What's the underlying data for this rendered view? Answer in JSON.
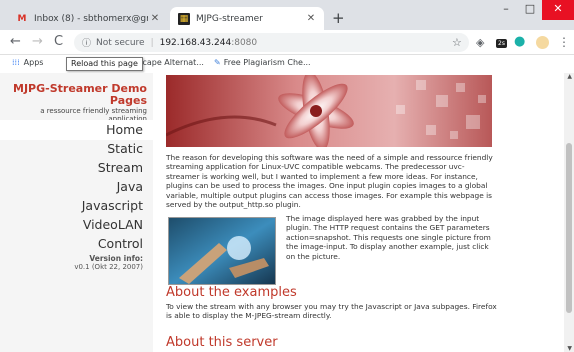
{
  "browser": {
    "tabs": [
      {
        "title": "Inbox (8) - sbthomerx@gmail.co",
        "close": "✕"
      },
      {
        "title": "MJPG-streamer",
        "close": "✕"
      }
    ],
    "new_tab": "+",
    "window_controls": {
      "minimize": "–",
      "maximize": "□",
      "close": "✕"
    },
    "nav": {
      "back": "←",
      "forward": "→",
      "reload": "C"
    },
    "address": {
      "security": "Not secure",
      "host": "192.168.43.244",
      "port": ":8080"
    },
    "bookmarks": [
      {
        "label": "Apps"
      },
      {
        "label": "Copyscape Alternat..."
      },
      {
        "label": "Free Plagiarism Che..."
      }
    ],
    "tooltip": "Reload this page",
    "extension_badge": "2s"
  },
  "sidebar": {
    "title": "MJPG-Streamer Demo Pages",
    "subtitle": "a ressource friendly streaming application",
    "nav": [
      "Home",
      "Static",
      "Stream",
      "Java",
      "Javascript",
      "VideoLAN",
      "Control"
    ],
    "version_label": "Version info:",
    "version_value": "v0.1 (Okt 22, 2007)"
  },
  "content": {
    "intro": "The reason for developing this software was the need of a simple and ressource friendly streaming application for Linux-UVC compatible webcams. The predecessor uvc-streamer is working well, but I wanted to implement a few more ideas. For instance, plugins can be used to process the images. One input plugin copies images to a global variable, multiple output plugins can access those images. For example this webpage is served by the output_http.so plugin.",
    "image_text": "The image displayed here was grabbed by the input plugin. The HTTP request contains the GET parameters action=snapshot. This requests one single picture from the image-input. To display another example, just click on the picture.",
    "examples_heading": "About the examples",
    "examples_text": "To view the stream with any browser you may try the Javascript or Java subpages. Firefox is able to display the M-JPEG-stream directly.",
    "server_heading": "About this server"
  },
  "colors": {
    "accent": "#c0392b",
    "sidebar_bg": "#f5f5f5",
    "close_button": "#e81123"
  }
}
